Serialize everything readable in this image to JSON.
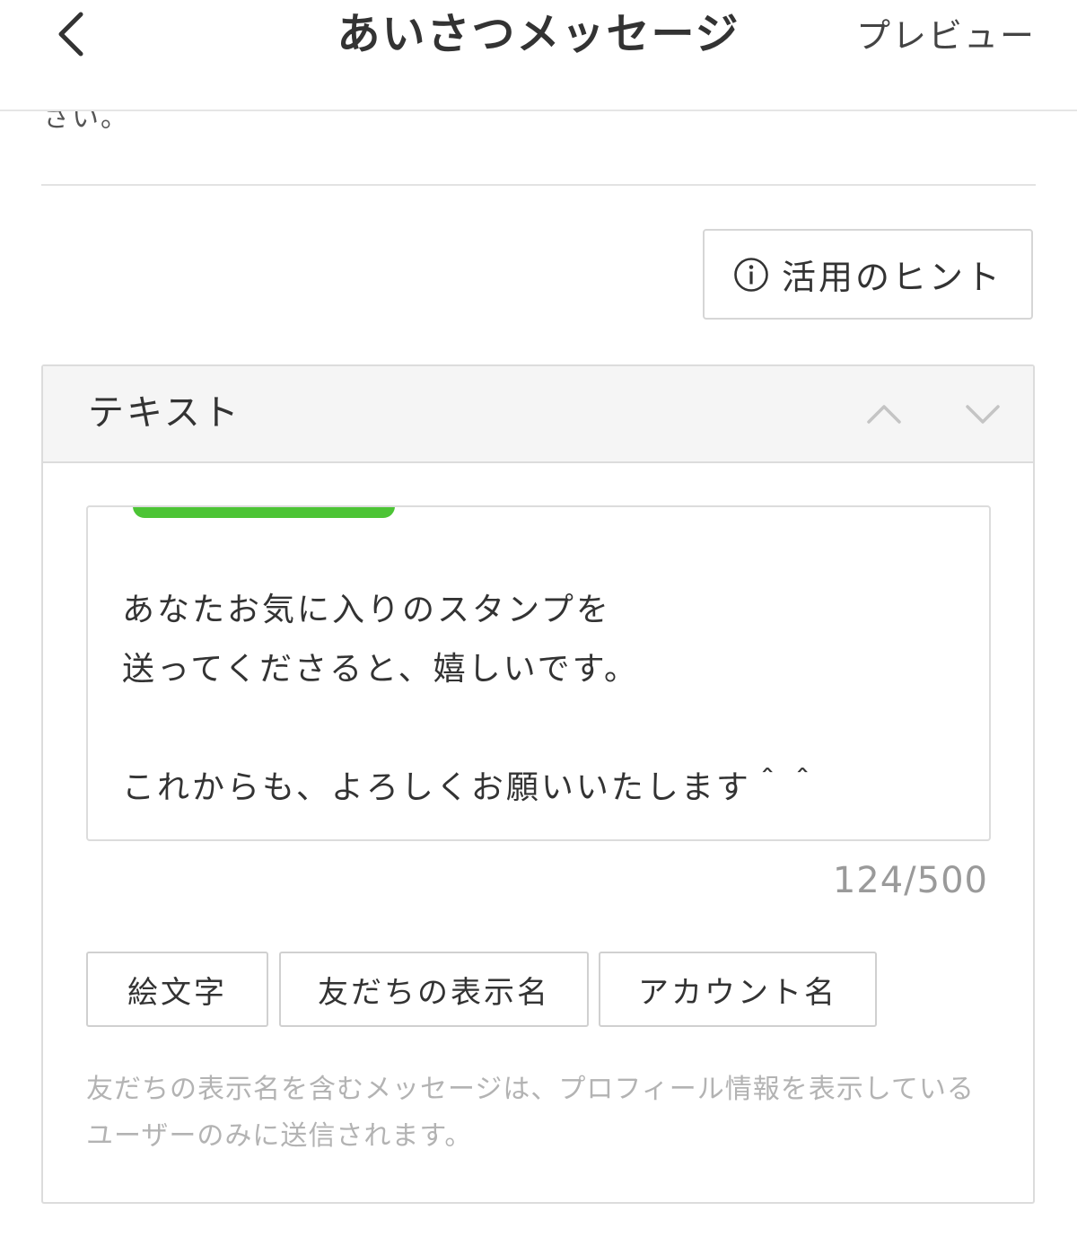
{
  "header": {
    "title": "あいさつメッセージ",
    "preview_label": "プレビュー",
    "back_icon": "chevron-left-icon"
  },
  "intro": {
    "cut_text": "さい。"
  },
  "hint_button": {
    "label": "活用のヒント",
    "icon": "info-icon"
  },
  "text_card": {
    "title": "テキスト",
    "move_up_icon": "chevron-up-icon",
    "move_down_icon": "chevron-down-icon",
    "message": "あなたお気に入りのスタンプを\n送ってくださると、嬉しいです。\n\nこれからも、よろしくお願いいたします＾＾",
    "char_count": "124/500",
    "insert_buttons": {
      "emoji": "絵文字",
      "friend_name": "友だちの表示名",
      "account_name": "アカウント名"
    },
    "note": "友だちの表示名を含むメッセージは、プロフィール情報を表示しているユーザーのみに送信されます。"
  },
  "colors": {
    "accent_green": "#4cc435",
    "border": "#dcdcdc",
    "muted_text": "#b3b3b3",
    "counter_text": "#9a9a9a"
  }
}
